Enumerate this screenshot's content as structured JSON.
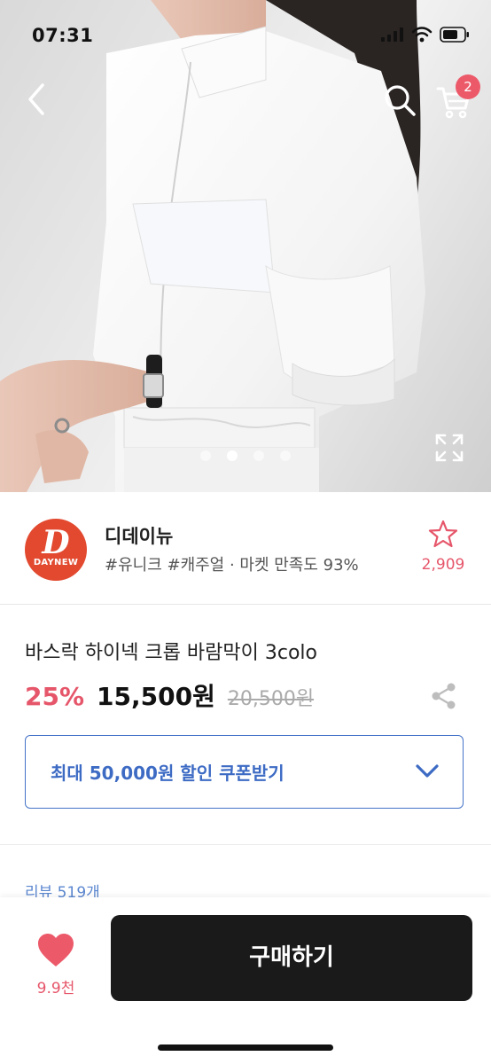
{
  "status_bar": {
    "time": "07:31"
  },
  "header": {
    "cart_badge": "2",
    "icons": [
      "back-arrow-icon",
      "search-icon",
      "cart-icon"
    ]
  },
  "gallery": {
    "page_count": 4,
    "active_index": 1,
    "expand_icon": "expand-icon"
  },
  "seller": {
    "logo_letter": "D",
    "logo_text": "DAYNEW",
    "name": "디데이뉴",
    "tags": "#유니크 #캐주얼 · 마켓 만족도 93%",
    "favorite_count": "2,909",
    "favorite_icon": "star-outline-icon"
  },
  "product": {
    "title": "바스락 하이넥 크롭 바람막이 3colo",
    "discount": "25%",
    "price": "15,500원",
    "original_price": "20,500원",
    "share_icon": "share-icon"
  },
  "coupon": {
    "label": "최대 50,000원 할인 쿠폰받기",
    "icon": "chevron-down-icon"
  },
  "reviews": {
    "label": "리뷰 519개"
  },
  "bottom_bar": {
    "like_count": "9.9천",
    "like_icon": "heart-icon",
    "buy_label": "구매하기"
  },
  "colors": {
    "accent_pink": "#e6566a",
    "badge_pink": "#ec5a6a",
    "coupon_blue": "#3d6bc4",
    "logo_red": "#e2492f",
    "buy_button": "#1a1a1a"
  }
}
